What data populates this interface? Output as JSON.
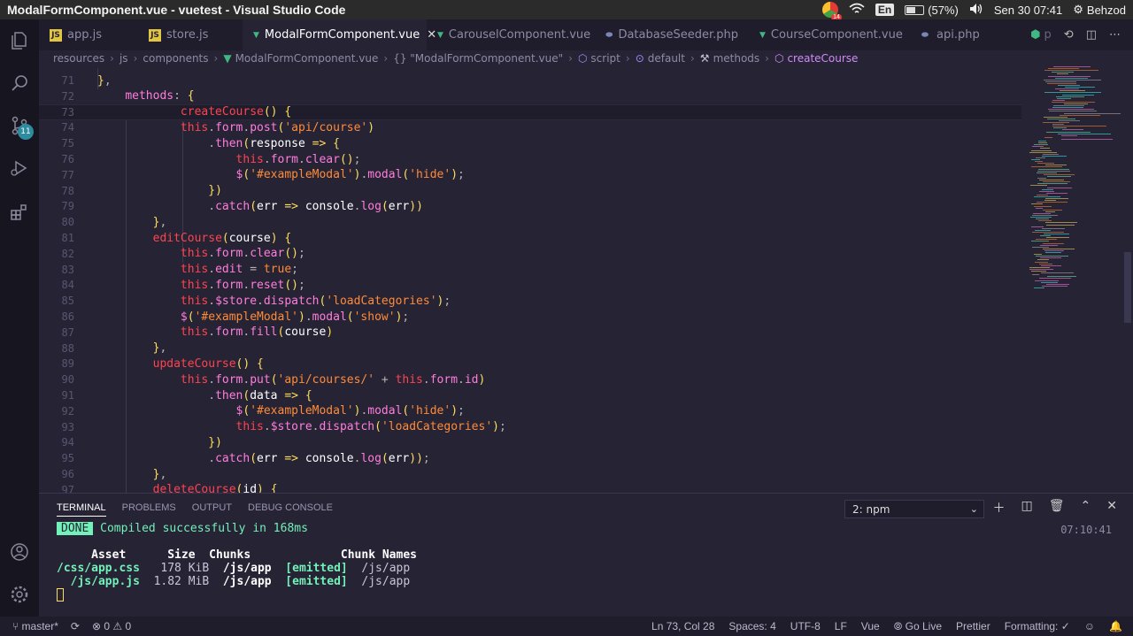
{
  "os": {
    "window_title": "ModalFormComponent.vue - vuetest - Visual Studio Code",
    "chrome_badge": "14",
    "lang": "En",
    "battery": "(57%)",
    "datetime": "Sen 30 07:41",
    "user": "Behzod"
  },
  "activity": {
    "scm_badge": "11"
  },
  "tabs": [
    {
      "label": "app.js",
      "type": "js",
      "active": false
    },
    {
      "label": "store.js",
      "type": "js",
      "active": false
    },
    {
      "label": "ModalFormComponent.vue",
      "type": "vue",
      "active": true
    },
    {
      "label": "CarouselComponent.vue",
      "type": "vue",
      "active": false
    },
    {
      "label": "DatabaseSeeder.php",
      "type": "php",
      "active": false
    },
    {
      "label": "CourseComponent.vue",
      "type": "vue",
      "active": false
    },
    {
      "label": "api.php",
      "type": "php",
      "active": false
    }
  ],
  "tab_overflow": "p",
  "breadcrumb": [
    "resources",
    "js",
    "components",
    "ModalFormComponent.vue",
    "{} \"ModalFormComponent.vue\"",
    "script",
    "default",
    "methods",
    "createCourse"
  ],
  "editor": {
    "current_line": 73,
    "lines": [
      {
        "n": "71",
        "code": "},"
      },
      {
        "n": "72",
        "code": "    methods: {"
      },
      {
        "n": "73",
        "code": "            createCourse() {"
      },
      {
        "n": "74",
        "code": "            this.form.post('api/course')"
      },
      {
        "n": "75",
        "code": "                .then(response => {"
      },
      {
        "n": "76",
        "code": "                    this.form.clear();"
      },
      {
        "n": "77",
        "code": "                    $('#exampleModal').modal('hide');"
      },
      {
        "n": "78",
        "code": "                })"
      },
      {
        "n": "79",
        "code": "                .catch(err => console.log(err))"
      },
      {
        "n": "80",
        "code": "        },"
      },
      {
        "n": "81",
        "code": "        editCourse(course) {"
      },
      {
        "n": "82",
        "code": "            this.form.clear();"
      },
      {
        "n": "83",
        "code": "            this.edit = true;"
      },
      {
        "n": "84",
        "code": "            this.form.reset();"
      },
      {
        "n": "85",
        "code": "            this.$store.dispatch('loadCategories');"
      },
      {
        "n": "86",
        "code": "            $('#exampleModal').modal('show');"
      },
      {
        "n": "87",
        "code": "            this.form.fill(course)"
      },
      {
        "n": "88",
        "code": "        },"
      },
      {
        "n": "89",
        "code": "        updateCourse() {"
      },
      {
        "n": "90",
        "code": "            this.form.put('api/courses/' + this.form.id)"
      },
      {
        "n": "91",
        "code": "                .then(data => {"
      },
      {
        "n": "92",
        "code": "                    $('#exampleModal').modal('hide');"
      },
      {
        "n": "93",
        "code": "                    this.$store.dispatch('loadCategories');"
      },
      {
        "n": "94",
        "code": "                })"
      },
      {
        "n": "95",
        "code": "                .catch(err => console.log(err));"
      },
      {
        "n": "96",
        "code": "        },"
      },
      {
        "n": "97",
        "code": "        deleteCourse(id) {"
      }
    ]
  },
  "panel": {
    "tabs": [
      "TERMINAL",
      "PROBLEMS",
      "OUTPUT",
      "DEBUG CONSOLE"
    ],
    "terminal_select": "2: npm",
    "done": "DONE",
    "compiled": "Compiled successfully in 168ms",
    "time": "07:10:41",
    "table_header": "     Asset      Size  Chunks             Chunk Names",
    "row1_asset": "/css/app.css",
    "row1_rest": "   178 KiB  ",
    "row1_chunk": "/js/app",
    "row1_emitted": "[emitted]",
    "row1_name": "/js/app",
    "row2_asset": "  /js/app.js",
    "row2_rest": "  1.82 MiB  ",
    "row2_chunk": "/js/app",
    "row2_emitted": "[emitted]",
    "row2_name": "/js/app"
  },
  "status": {
    "branch": "master*",
    "errors": "0",
    "warnings": "0",
    "position": "Ln 73, Col 28",
    "spaces": "Spaces: 4",
    "encoding": "UTF-8",
    "eol": "LF",
    "language": "Vue",
    "golive": "Go Live",
    "prettier": "Prettier",
    "formatting": "Formatting: ✓"
  }
}
